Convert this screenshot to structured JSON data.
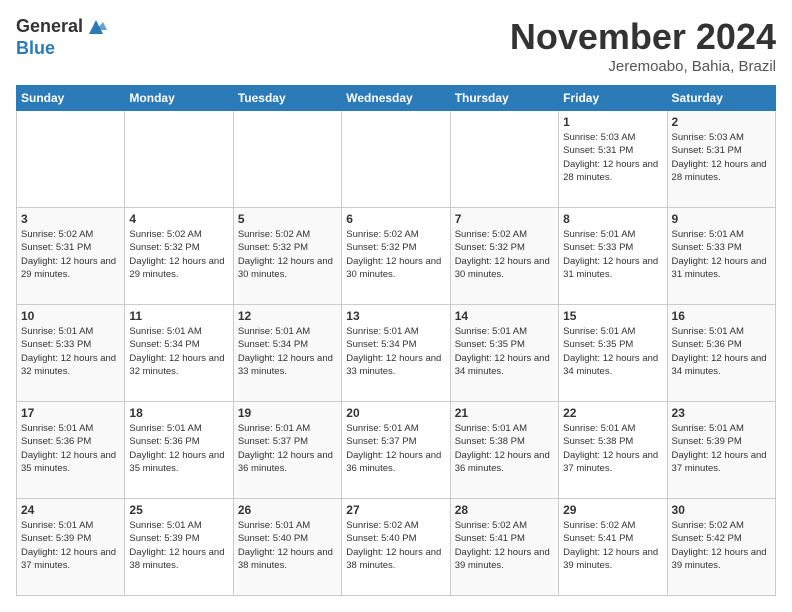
{
  "header": {
    "logo_line1": "General",
    "logo_line2": "Blue",
    "title": "November 2024",
    "location": "Jeremoabo, Bahia, Brazil"
  },
  "days_of_week": [
    "Sunday",
    "Monday",
    "Tuesday",
    "Wednesday",
    "Thursday",
    "Friday",
    "Saturday"
  ],
  "weeks": [
    [
      {
        "day": "",
        "info": ""
      },
      {
        "day": "",
        "info": ""
      },
      {
        "day": "",
        "info": ""
      },
      {
        "day": "",
        "info": ""
      },
      {
        "day": "",
        "info": ""
      },
      {
        "day": "1",
        "info": "Sunrise: 5:03 AM\nSunset: 5:31 PM\nDaylight: 12 hours\nand 28 minutes."
      },
      {
        "day": "2",
        "info": "Sunrise: 5:03 AM\nSunset: 5:31 PM\nDaylight: 12 hours\nand 28 minutes."
      }
    ],
    [
      {
        "day": "3",
        "info": "Sunrise: 5:02 AM\nSunset: 5:31 PM\nDaylight: 12 hours\nand 29 minutes."
      },
      {
        "day": "4",
        "info": "Sunrise: 5:02 AM\nSunset: 5:32 PM\nDaylight: 12 hours\nand 29 minutes."
      },
      {
        "day": "5",
        "info": "Sunrise: 5:02 AM\nSunset: 5:32 PM\nDaylight: 12 hours\nand 30 minutes."
      },
      {
        "day": "6",
        "info": "Sunrise: 5:02 AM\nSunset: 5:32 PM\nDaylight: 12 hours\nand 30 minutes."
      },
      {
        "day": "7",
        "info": "Sunrise: 5:02 AM\nSunset: 5:32 PM\nDaylight: 12 hours\nand 30 minutes."
      },
      {
        "day": "8",
        "info": "Sunrise: 5:01 AM\nSunset: 5:33 PM\nDaylight: 12 hours\nand 31 minutes."
      },
      {
        "day": "9",
        "info": "Sunrise: 5:01 AM\nSunset: 5:33 PM\nDaylight: 12 hours\nand 31 minutes."
      }
    ],
    [
      {
        "day": "10",
        "info": "Sunrise: 5:01 AM\nSunset: 5:33 PM\nDaylight: 12 hours\nand 32 minutes."
      },
      {
        "day": "11",
        "info": "Sunrise: 5:01 AM\nSunset: 5:34 PM\nDaylight: 12 hours\nand 32 minutes."
      },
      {
        "day": "12",
        "info": "Sunrise: 5:01 AM\nSunset: 5:34 PM\nDaylight: 12 hours\nand 33 minutes."
      },
      {
        "day": "13",
        "info": "Sunrise: 5:01 AM\nSunset: 5:34 PM\nDaylight: 12 hours\nand 33 minutes."
      },
      {
        "day": "14",
        "info": "Sunrise: 5:01 AM\nSunset: 5:35 PM\nDaylight: 12 hours\nand 34 minutes."
      },
      {
        "day": "15",
        "info": "Sunrise: 5:01 AM\nSunset: 5:35 PM\nDaylight: 12 hours\nand 34 minutes."
      },
      {
        "day": "16",
        "info": "Sunrise: 5:01 AM\nSunset: 5:36 PM\nDaylight: 12 hours\nand 34 minutes."
      }
    ],
    [
      {
        "day": "17",
        "info": "Sunrise: 5:01 AM\nSunset: 5:36 PM\nDaylight: 12 hours\nand 35 minutes."
      },
      {
        "day": "18",
        "info": "Sunrise: 5:01 AM\nSunset: 5:36 PM\nDaylight: 12 hours\nand 35 minutes."
      },
      {
        "day": "19",
        "info": "Sunrise: 5:01 AM\nSunset: 5:37 PM\nDaylight: 12 hours\nand 36 minutes."
      },
      {
        "day": "20",
        "info": "Sunrise: 5:01 AM\nSunset: 5:37 PM\nDaylight: 12 hours\nand 36 minutes."
      },
      {
        "day": "21",
        "info": "Sunrise: 5:01 AM\nSunset: 5:38 PM\nDaylight: 12 hours\nand 36 minutes."
      },
      {
        "day": "22",
        "info": "Sunrise: 5:01 AM\nSunset: 5:38 PM\nDaylight: 12 hours\nand 37 minutes."
      },
      {
        "day": "23",
        "info": "Sunrise: 5:01 AM\nSunset: 5:39 PM\nDaylight: 12 hours\nand 37 minutes."
      }
    ],
    [
      {
        "day": "24",
        "info": "Sunrise: 5:01 AM\nSunset: 5:39 PM\nDaylight: 12 hours\nand 37 minutes."
      },
      {
        "day": "25",
        "info": "Sunrise: 5:01 AM\nSunset: 5:39 PM\nDaylight: 12 hours\nand 38 minutes."
      },
      {
        "day": "26",
        "info": "Sunrise: 5:01 AM\nSunset: 5:40 PM\nDaylight: 12 hours\nand 38 minutes."
      },
      {
        "day": "27",
        "info": "Sunrise: 5:02 AM\nSunset: 5:40 PM\nDaylight: 12 hours\nand 38 minutes."
      },
      {
        "day": "28",
        "info": "Sunrise: 5:02 AM\nSunset: 5:41 PM\nDaylight: 12 hours\nand 39 minutes."
      },
      {
        "day": "29",
        "info": "Sunrise: 5:02 AM\nSunset: 5:41 PM\nDaylight: 12 hours\nand 39 minutes."
      },
      {
        "day": "30",
        "info": "Sunrise: 5:02 AM\nSunset: 5:42 PM\nDaylight: 12 hours\nand 39 minutes."
      }
    ]
  ]
}
